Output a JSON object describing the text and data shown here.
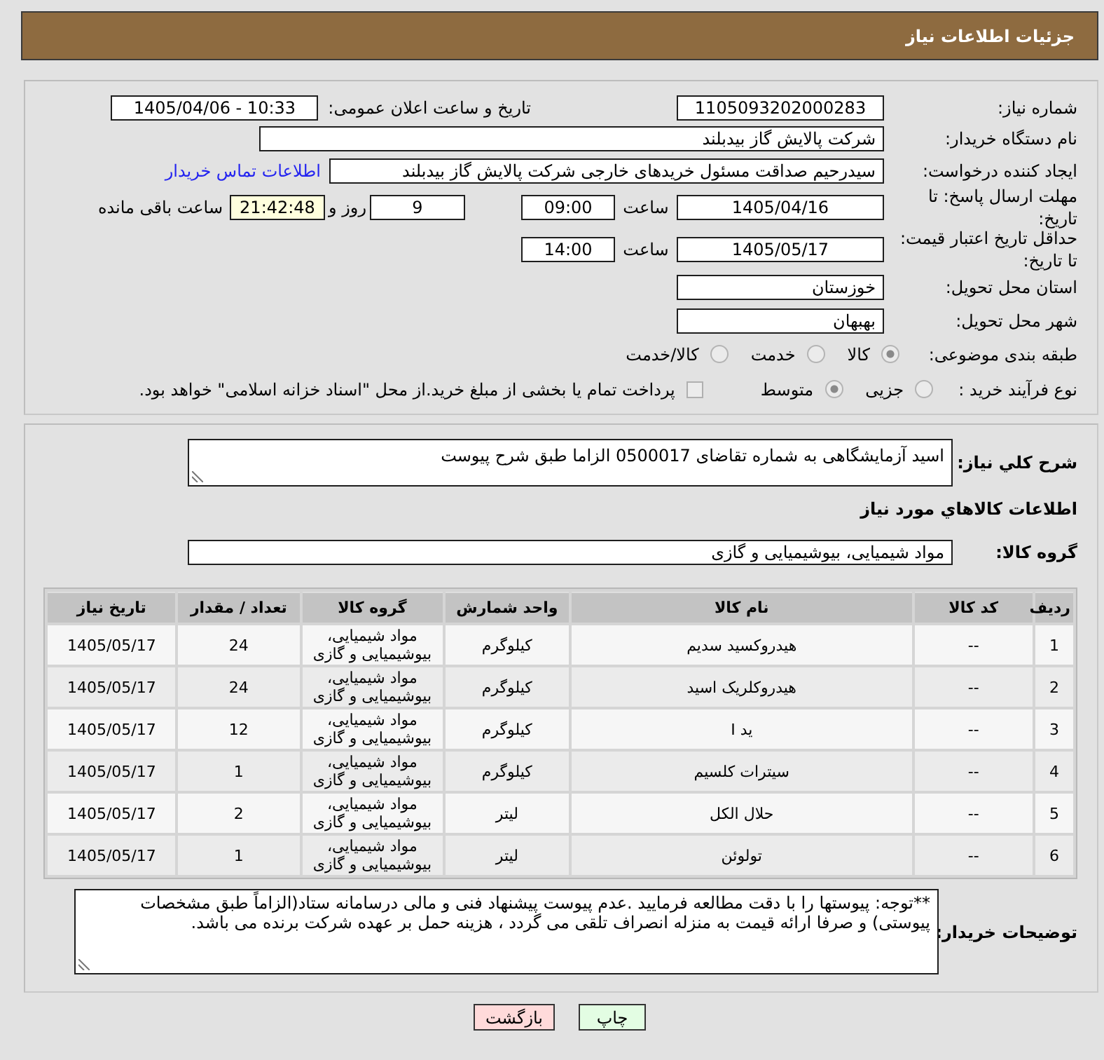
{
  "header": {
    "title": "جزئیات اطلاعات نیاز"
  },
  "summary": {
    "need_number": {
      "label": "شماره نیاز:",
      "value": "1105093202000283"
    },
    "announce": {
      "label": "تاریخ و ساعت اعلان عمومی:",
      "value": "1405/04/06 - 10:33"
    },
    "buyer_org": {
      "label": "نام دستگاه خریدار:",
      "value": "شرکت پالایش گاز بیدبلند"
    },
    "requester": {
      "label": "ایجاد کننده درخواست:",
      "value": "سیدرحیم صداقت مسئول خریدهای خارجی شرکت پالایش گاز بیدبلند",
      "contact_link": "اطلاعات تماس خریدار"
    },
    "reply_deadline": {
      "label": "مهلت ارسال پاسخ: تا تاریخ:",
      "date": "1405/04/16",
      "time_label": "ساعت",
      "time": "09:00",
      "days": "9",
      "days_label": "روز و",
      "remaining": "21:42:48",
      "remaining_label": "ساعت باقی مانده"
    },
    "price_validity": {
      "label": "حداقل تاریخ اعتبار قیمت: تا تاریخ:",
      "date": "1405/05/17",
      "time_label": "ساعت",
      "time": "14:00"
    },
    "delivery_province": {
      "label": "استان محل تحویل:",
      "value": "خوزستان"
    },
    "delivery_city": {
      "label": "شهر محل تحویل:",
      "value": "بهبهان"
    },
    "classification": {
      "label": "طبقه بندی موضوعی:",
      "options": [
        {
          "label": "کالا",
          "selected": true,
          "disabled": true
        },
        {
          "label": "خدمت",
          "selected": false,
          "disabled": true
        },
        {
          "label": "کالا/خدمت",
          "selected": false,
          "disabled": true
        }
      ]
    },
    "purchase_type": {
      "label": "نوع فرآیند خرید :",
      "options": [
        {
          "label": "جزیی",
          "selected": false,
          "disabled": true
        },
        {
          "label": "متوسط",
          "selected": true,
          "disabled": true
        }
      ],
      "treasury_payment": {
        "label": "پرداخت تمام یا بخشی از مبلغ خرید.از محل \"اسناد خزانه اسلامی\" خواهد بود.",
        "checked": false,
        "disabled": true
      }
    }
  },
  "details": {
    "description": {
      "label": "شرح كلي نیاز:",
      "value": "اسید آزمایشگاهی به شماره تقاضای 0500017 الزاما طبق شرح پیوست"
    },
    "goods_heading": "اطلاعات كالاهاي مورد نياز",
    "goods_group": {
      "label": "گروه کالا:",
      "value": "مواد شیمیایی، بیوشیمیایی و گازی"
    },
    "table": {
      "columns": [
        "ردیف",
        "کد کالا",
        "نام کالا",
        "واحد شمارش",
        "گروه کالا",
        "تعداد / مقدار",
        "تاریخ نیاز"
      ],
      "rows": [
        [
          "1",
          "--",
          "هیدروکسید سدیم",
          "کیلوگرم",
          "مواد شیمیایی، بیوشیمیایی و گازی",
          "24",
          "1405/05/17"
        ],
        [
          "2",
          "--",
          "هیدروکلریک اسید",
          "کیلوگرم",
          "مواد شیمیایی، بیوشیمیایی و گازی",
          "24",
          "1405/05/17"
        ],
        [
          "3",
          "--",
          "ید I",
          "کیلوگرم",
          "مواد شیمیایی، بیوشیمیایی و گازی",
          "12",
          "1405/05/17"
        ],
        [
          "4",
          "--",
          "سیترات کلسیم",
          "کیلوگرم",
          "مواد شیمیایی، بیوشیمیایی و گازی",
          "1",
          "1405/05/17"
        ],
        [
          "5",
          "--",
          "حلال الکل",
          "لیتر",
          "مواد شیمیایی، بیوشیمیایی و گازی",
          "2",
          "1405/05/17"
        ],
        [
          "6",
          "--",
          "تولوئن",
          "لیتر",
          "مواد شیمیایی، بیوشیمیایی و گازی",
          "1",
          "1405/05/17"
        ]
      ]
    },
    "buyer_notes": {
      "label": "توضیحات خریدار:",
      "value": "**توجه: پیوستها را با دقت مطالعه فرمایید .عدم پیوست پیشنهاد فنی و مالی درسامانه ستاد(الزاماً طبق مشخصات پیوستی) و صرفا ارائه قیمت به منزله انصراف تلقی می گردد ، هزینه حمل بر عهده شرکت برنده می باشد."
    }
  },
  "buttons": [
    {
      "label": "چاپ",
      "kind": "print"
    },
    {
      "label": "بازگشت",
      "kind": "back"
    }
  ]
}
